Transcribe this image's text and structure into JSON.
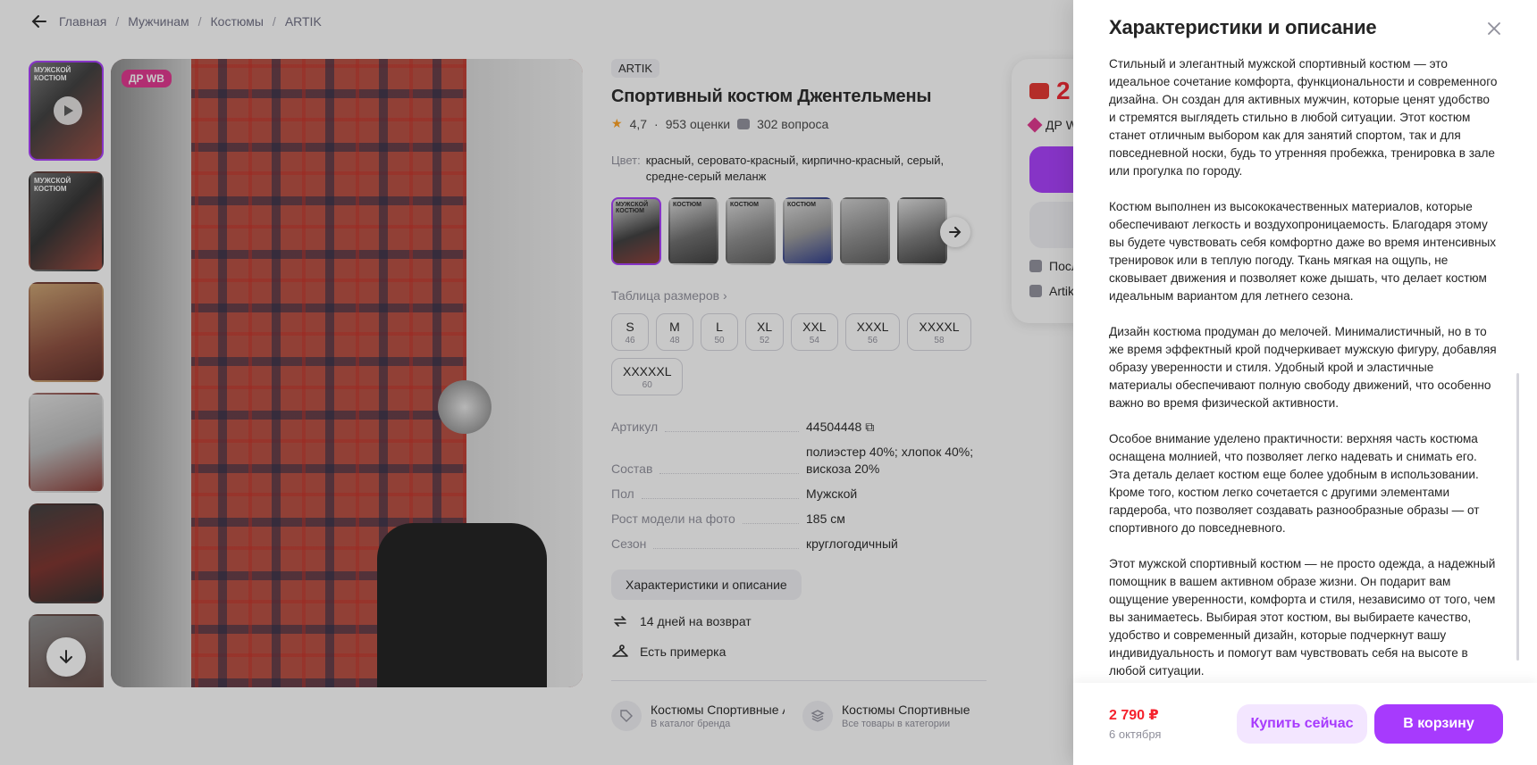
{
  "breadcrumb": [
    "Главная",
    "Мужчинам",
    "Костюмы",
    "ARTIK"
  ],
  "thumbs": [
    {
      "title": "Мужской костюм",
      "video": true
    },
    {
      "title": "Мужской костюм"
    },
    {
      "title": ""
    },
    {
      "title": ""
    },
    {
      "title": ""
    },
    {
      "title": ""
    }
  ],
  "main_image": {
    "badge": "ДР WB"
  },
  "product": {
    "brand": "ARTIK",
    "title": "Спортивный костюм Джентельмены",
    "rating": "4,7",
    "reviews": "953 оценки",
    "questions": "302 вопроса",
    "color_label": "Цвет:",
    "colors": "красный, серовато-красный, кирпично-красный, серый, средне-серый меланж",
    "swatch_labels": [
      "МУЖСКОЙ КОСТЮМ",
      "КОСТЮМ",
      "КОСТЮМ",
      "КОСТЮМ",
      "",
      ""
    ],
    "size_table_label": "Таблица размеров",
    "sizes": [
      {
        "s": "S",
        "n": "46"
      },
      {
        "s": "M",
        "n": "48"
      },
      {
        "s": "L",
        "n": "50"
      },
      {
        "s": "XL",
        "n": "52"
      },
      {
        "s": "XXL",
        "n": "54"
      },
      {
        "s": "XXXL",
        "n": "56"
      },
      {
        "s": "XXXXL",
        "n": "58"
      },
      {
        "s": "XXXXXL",
        "n": "60"
      }
    ],
    "specs": [
      {
        "k": "Артикул",
        "v": "44504448"
      },
      {
        "k": "Состав",
        "v": "полиэстер 40%; хлопок 40%; вискоза 20%"
      },
      {
        "k": "Пол",
        "v": "Мужской"
      },
      {
        "k": "Рост модели на фото",
        "v": "185 см"
      },
      {
        "k": "Сезон",
        "v": "круглогодичный"
      }
    ],
    "desc_button": "Характеристики и описание",
    "perks": [
      "14 дней на возврат",
      "Есть примерка"
    ],
    "cats": [
      {
        "title": "Костюмы Спортивные ARTIK",
        "sub": "В каталог бренда"
      },
      {
        "title": "Костюмы Спортивные",
        "sub": "Все товары в категории"
      }
    ]
  },
  "price_card": {
    "price": "2",
    "dr": "ДР W",
    "row1": "Посл",
    "row2": "Artik"
  },
  "drawer": {
    "title": "Характеристики и описание",
    "paragraphs": [
      "Стильный и элегантный мужской спортивный костюм — это идеальное сочетание комфорта, функциональности и современного дизайна. Он создан для активных мужчин, которые ценят удобство и стремятся выглядеть стильно в любой ситуации. Этот костюм станет отличным выбором как для занятий спортом, так и для повседневной носки, будь то утренняя пробежка, тренировка в зале или прогулка по городу.",
      "Костюм выполнен из высококачественных материалов, которые обеспечивают легкость и воздухопроницаемость. Благодаря этому вы будете чувствовать себя комфортно даже во время интенсивных тренировок или в теплую погоду. Ткань мягкая на ощупь, не сковывает движения и позволяет коже дышать, что делает костюм идеальным вариантом для летнего сезона.",
      "Дизайн костюма продуман до мелочей. Минималистичный, но в то же время эффектный крой подчеркивает мужскую фигуру, добавляя образу уверенности и стиля. Удобный крой и эластичные материалы обеспечивают полную свободу движений, что особенно важно во время физической активности.",
      "Особое внимание уделено практичности: верхняя часть костюма оснащена молнией, что позволяет легко надевать и снимать его. Эта деталь делает костюм еще более удобным в использовании. Кроме того, костюм легко сочетается с другими элементами гардероба, что позволяет создавать разнообразные образы — от спортивного до повседневного.",
      "Этот мужской спортивный костюм — не просто одежда, а надежный помощник в вашем активном образе жизни. Он подарит вам ощущение уверенности, комфорта и стиля, независимо от того, чем вы занимаетесь. Выбирая этот костюм, вы выбираете качество, удобство и современный дизайн, которые подчеркнут вашу индивидуальность и помогут вам чувствовать себя на высоте в любой ситуации."
    ],
    "price": "2 790 ₽",
    "date": "6 октября",
    "buy_now": "Купить сейчас",
    "to_cart": "В корзину"
  },
  "colors": {
    "accent": "#a73afd",
    "price": "#f5222d",
    "badge": "#e0328c"
  }
}
